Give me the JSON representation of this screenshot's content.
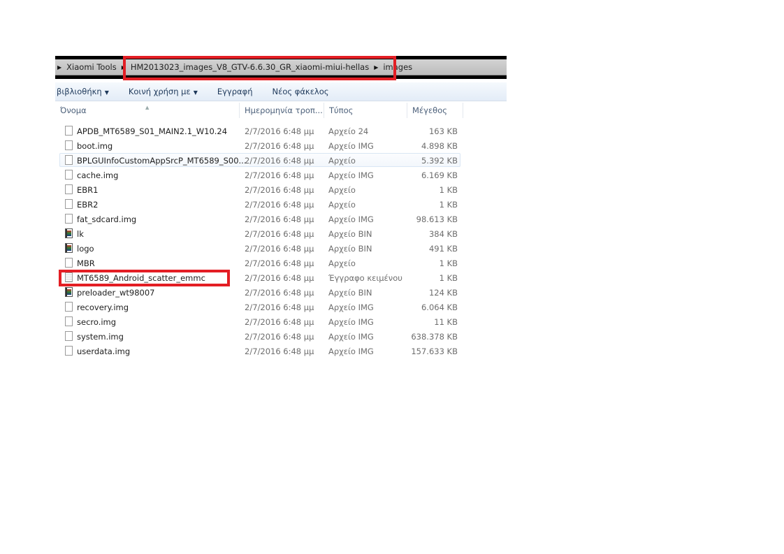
{
  "breadcrumb": [
    "Xiaomi Tools",
    "HM2013023_images_V8_GTV-6.6.30_GR_xiaomi-miui-hellas",
    "images"
  ],
  "toolbar": {
    "library": "βιβλιοθήκη",
    "share": "Κοινή χρήση με",
    "burn": "Εγγραφή",
    "new_folder": "Νέος φάκελος"
  },
  "columns": {
    "name": "Όνομα",
    "date": "Ημερομηνία τροπ...",
    "type": "Τύπος",
    "size": "Μέγεθος"
  },
  "files": [
    {
      "name": "APDB_MT6589_S01_MAIN2.1_W10.24",
      "date": "2/7/2016 6:48 μμ",
      "type": "Αρχείο 24",
      "size": "163 KB",
      "icon": "file"
    },
    {
      "name": "boot.img",
      "date": "2/7/2016 6:48 μμ",
      "type": "Αρχείο IMG",
      "size": "4.898 KB",
      "icon": "file"
    },
    {
      "name": "BPLGUInfoCustomAppSrcP_MT6589_S00...",
      "date": "2/7/2016 6:48 μμ",
      "type": "Αρχείο",
      "size": "5.392 KB",
      "icon": "file"
    },
    {
      "name": "cache.img",
      "date": "2/7/2016 6:48 μμ",
      "type": "Αρχείο IMG",
      "size": "6.169 KB",
      "icon": "file"
    },
    {
      "name": "EBR1",
      "date": "2/7/2016 6:48 μμ",
      "type": "Αρχείο",
      "size": "1 KB",
      "icon": "file"
    },
    {
      "name": "EBR2",
      "date": "2/7/2016 6:48 μμ",
      "type": "Αρχείο",
      "size": "1 KB",
      "icon": "file"
    },
    {
      "name": "fat_sdcard.img",
      "date": "2/7/2016 6:48 μμ",
      "type": "Αρχείο IMG",
      "size": "98.613 KB",
      "icon": "file"
    },
    {
      "name": "lk",
      "date": "2/7/2016 6:48 μμ",
      "type": "Αρχείο BIN",
      "size": "384 KB",
      "icon": "bin"
    },
    {
      "name": "logo",
      "date": "2/7/2016 6:48 μμ",
      "type": "Αρχείο BIN",
      "size": "491 KB",
      "icon": "bin"
    },
    {
      "name": "MBR",
      "date": "2/7/2016 6:48 μμ",
      "type": "Αρχείο",
      "size": "1 KB",
      "icon": "file"
    },
    {
      "name": "MT6589_Android_scatter_emmc",
      "date": "2/7/2016 6:48 μμ",
      "type": "Έγγραφο κειμένου",
      "size": "1 KB",
      "icon": "txt"
    },
    {
      "name": "preloader_wt98007",
      "date": "2/7/2016 6:48 μμ",
      "type": "Αρχείο BIN",
      "size": "124 KB",
      "icon": "bin"
    },
    {
      "name": "recovery.img",
      "date": "2/7/2016 6:48 μμ",
      "type": "Αρχείο IMG",
      "size": "6.064 KB",
      "icon": "file"
    },
    {
      "name": "secro.img",
      "date": "2/7/2016 6:48 μμ",
      "type": "Αρχείο IMG",
      "size": "11 KB",
      "icon": "file"
    },
    {
      "name": "system.img",
      "date": "2/7/2016 6:48 μμ",
      "type": "Αρχείο IMG",
      "size": "638.378 KB",
      "icon": "file"
    },
    {
      "name": "userdata.img",
      "date": "2/7/2016 6:48 μμ",
      "type": "Αρχείο IMG",
      "size": "157.633 KB",
      "icon": "file"
    }
  ],
  "highlight_color": "#e31e24"
}
